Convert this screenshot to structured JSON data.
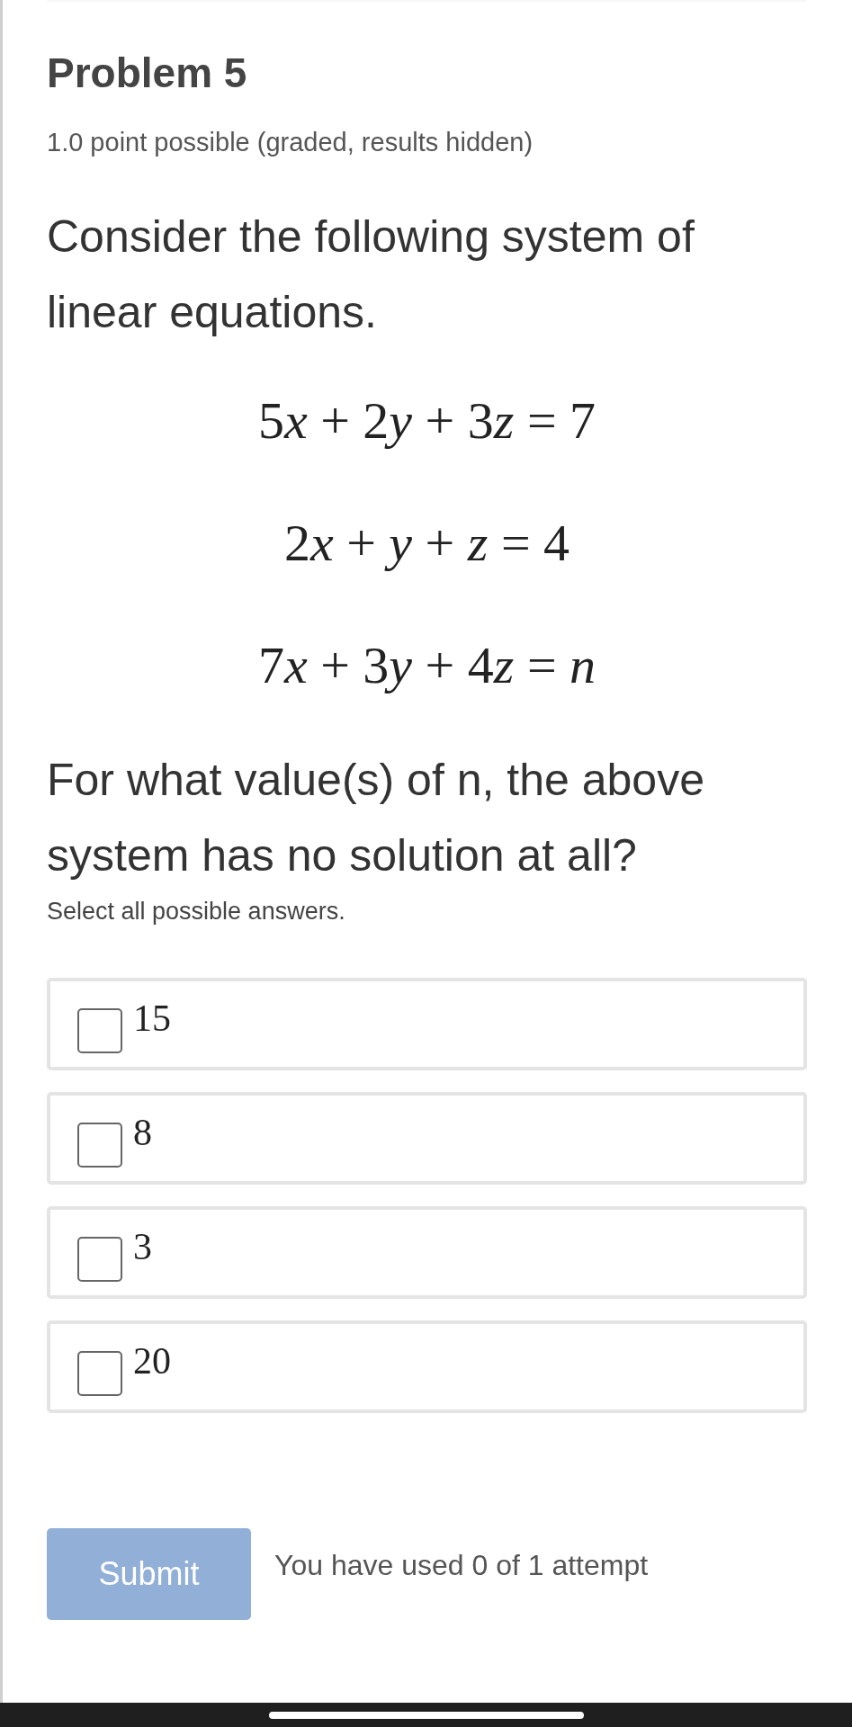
{
  "problem": {
    "title": "Problem 5",
    "meta": "1.0 point possible (graded, results hidden)"
  },
  "intro": "Consider the following system of linear equations.",
  "equations": [
    "5x + 2y + 3z = 7",
    "2x + y + z = 4",
    "7x + 3y + 4z = n"
  ],
  "question": "For what value(s) of n, the above system has no solution at all?",
  "hint": "Select all possible answers.",
  "options": [
    {
      "label": "15",
      "checked": false
    },
    {
      "label": "8",
      "checked": false
    },
    {
      "label": "3",
      "checked": false
    },
    {
      "label": "20",
      "checked": false
    }
  ],
  "submit": {
    "label": "Submit",
    "disabled": true
  },
  "attempts": "You have used 0 of 1 attempt"
}
